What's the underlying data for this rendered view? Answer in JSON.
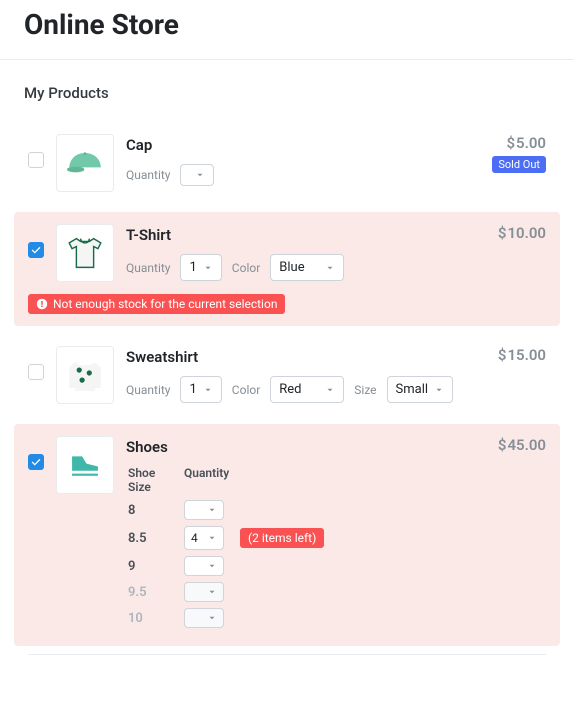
{
  "header": {
    "title": "Online Store"
  },
  "section": {
    "title": "My Products"
  },
  "labels": {
    "quantity": "Quantity",
    "color": "Color",
    "size": "Size",
    "shoe_size": "Shoe Size",
    "sold_out": "Sold Out",
    "currency": "$"
  },
  "products": [
    {
      "name": "Cap",
      "price": "5.00",
      "selected": false,
      "sold_out": true,
      "quantity": ""
    },
    {
      "name": "T-Shirt",
      "price": "10.00",
      "selected": true,
      "quantity": "1",
      "color": "Blue",
      "warning": "Not enough stock for the current selection"
    },
    {
      "name": "Sweatshirt",
      "price": "15.00",
      "selected": false,
      "quantity": "1",
      "color": "Red",
      "size": "Small"
    },
    {
      "name": "Shoes",
      "price": "45.00",
      "selected": true,
      "size_table": [
        {
          "size": "8",
          "qty": "",
          "disabled": false
        },
        {
          "size": "8.5",
          "qty": "4",
          "disabled": false,
          "warn": "(2 items left)"
        },
        {
          "size": "9",
          "qty": "",
          "disabled": false
        },
        {
          "size": "9.5",
          "qty": "",
          "disabled": true
        },
        {
          "size": "10",
          "qty": "",
          "disabled": true
        }
      ]
    }
  ]
}
